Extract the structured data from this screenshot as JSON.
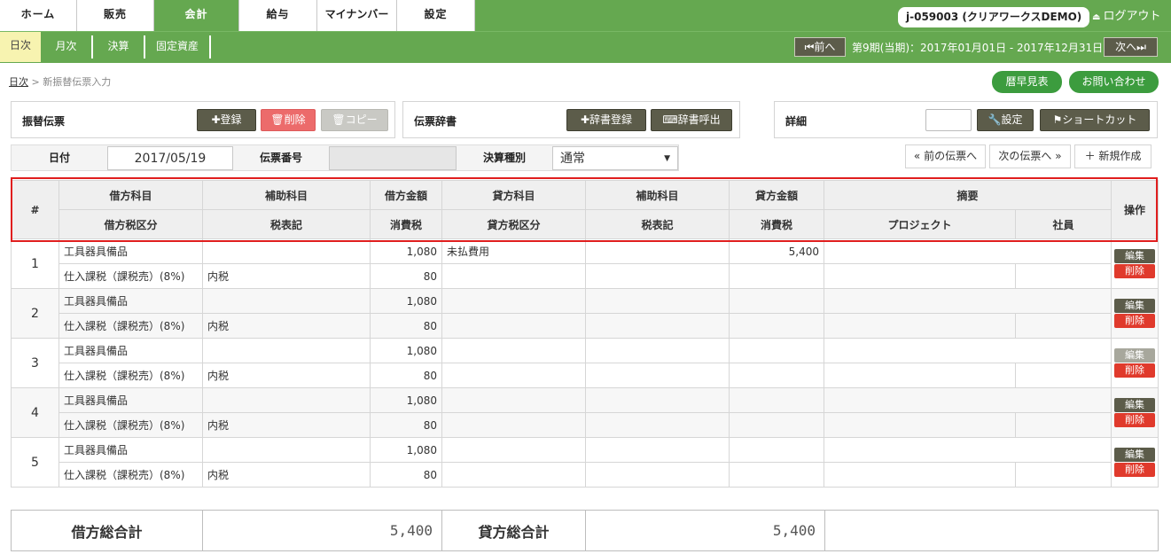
{
  "nav": {
    "tabs": [
      "ホーム",
      "販売",
      "会計",
      "給与",
      "マイナンバー",
      "設定"
    ],
    "user": "j-059003 (クリアワークスDEMO)",
    "logout": "ログアウト"
  },
  "subnav": {
    "items": [
      "日次",
      "月次",
      "決算",
      "固定資産"
    ],
    "prev": "⏮前へ",
    "next": "次へ⏭",
    "period": "第9期(当期)：2017年01月01日 - 2017年12月31日"
  },
  "breadcrumb": {
    "root": "日次",
    "sep": ">",
    "current": "新振替伝票入力"
  },
  "top_buttons": {
    "calendar": "暦早見表",
    "contact": "お問い合わせ"
  },
  "voucher_panel": {
    "title": "振替伝票",
    "register": "✚登録",
    "delete": "🗑削除",
    "copy": "🗑コピー"
  },
  "dict_panel": {
    "title": "伝票辞書",
    "dict_register": "✚辞書登録",
    "dict_call": "⌨辞書呼出"
  },
  "detail_panel": {
    "title": "詳細",
    "settings": "🔧設定",
    "shortcut": "⚑ショートカット"
  },
  "form": {
    "date_label": "日付",
    "date_value": "2017/05/19",
    "number_label": "伝票番号",
    "number_value": "",
    "type_label": "決算種別",
    "type_value": "通常"
  },
  "voucher_nav": {
    "prev": "« 前の伝票へ",
    "next": "次の伝票へ »",
    "new": "＋ 新規作成"
  },
  "table": {
    "h1": [
      "#",
      "借方科目",
      "補助科目",
      "借方金額",
      "貸方科目",
      "補助科目",
      "貸方金額",
      "摘要",
      "操作"
    ],
    "h2": [
      "借方税区分",
      "税表記",
      "消費税",
      "貸方税区分",
      "税表記",
      "消費税",
      "プロジェクト",
      "社員"
    ],
    "edit": "編集",
    "del": "削除",
    "rows": [
      {
        "no": "1",
        "debit_acct": "工具器具備品",
        "debit_sub": "",
        "debit_amt": "1,080",
        "credit_acct": "未払費用",
        "credit_sub": "",
        "credit_amt": "5,400",
        "summary": "",
        "debit_tax": "仕入課税（課税売）(8%)",
        "tax_note": "内税",
        "tax_amt": "80",
        "credit_tax": "",
        "credit_note": "",
        "credit_tax_amt": "",
        "project": "",
        "staff": ""
      },
      {
        "no": "2",
        "debit_acct": "工具器具備品",
        "debit_sub": "",
        "debit_amt": "1,080",
        "credit_acct": "",
        "credit_sub": "",
        "credit_amt": "",
        "summary": "",
        "debit_tax": "仕入課税（課税売）(8%)",
        "tax_note": "内税",
        "tax_amt": "80",
        "credit_tax": "",
        "credit_note": "",
        "credit_tax_amt": "",
        "project": "",
        "staff": ""
      },
      {
        "no": "3",
        "debit_acct": "工具器具備品",
        "debit_sub": "",
        "debit_amt": "1,080",
        "credit_acct": "",
        "credit_sub": "",
        "credit_amt": "",
        "summary": "",
        "debit_tax": "仕入課税（課税売）(8%)",
        "tax_note": "内税",
        "tax_amt": "80",
        "credit_tax": "",
        "credit_note": "",
        "credit_tax_amt": "",
        "project": "",
        "staff": ""
      },
      {
        "no": "4",
        "debit_acct": "工具器具備品",
        "debit_sub": "",
        "debit_amt": "1,080",
        "credit_acct": "",
        "credit_sub": "",
        "credit_amt": "",
        "summary": "",
        "debit_tax": "仕入課税（課税売）(8%)",
        "tax_note": "内税",
        "tax_amt": "80",
        "credit_tax": "",
        "credit_note": "",
        "credit_tax_amt": "",
        "project": "",
        "staff": ""
      },
      {
        "no": "5",
        "debit_acct": "工具器具備品",
        "debit_sub": "",
        "debit_amt": "1,080",
        "credit_acct": "",
        "credit_sub": "",
        "credit_amt": "",
        "summary": "",
        "debit_tax": "仕入課税（課税売）(8%)",
        "tax_note": "内税",
        "tax_amt": "80",
        "credit_tax": "",
        "credit_note": "",
        "credit_tax_amt": "",
        "project": "",
        "staff": ""
      }
    ]
  },
  "totals": {
    "debit_label": "借方総合計",
    "debit_value": "5,400",
    "credit_label": "貸方総合計",
    "credit_value": "5,400"
  },
  "colors": {
    "nav_green": "#65a850",
    "button_dark": "#5c5c4a",
    "delete_red": "#e03a2c",
    "highlight_red": "#e01e1e",
    "accent_green": "#3c9c3e"
  }
}
